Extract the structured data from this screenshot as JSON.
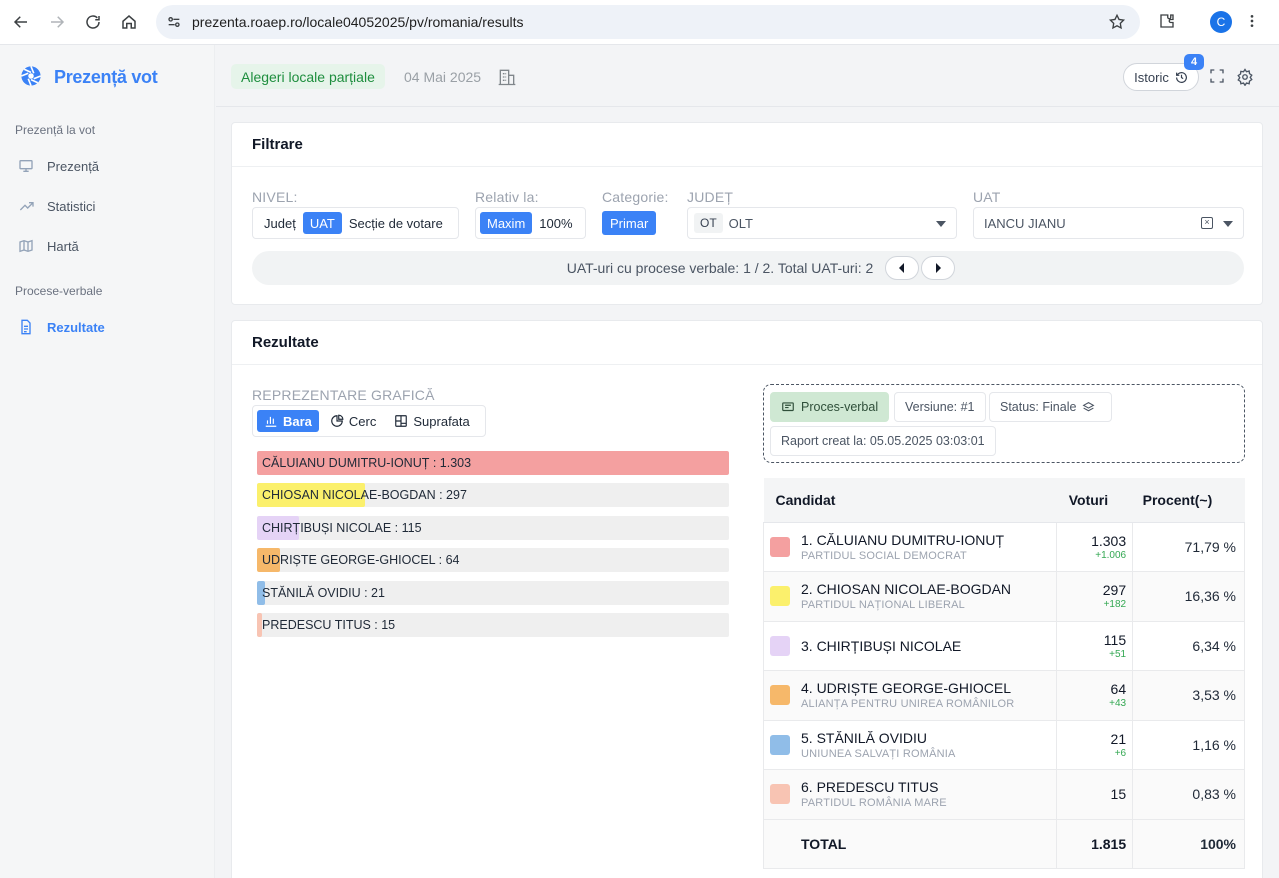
{
  "browser": {
    "url": "prezenta.roaep.ro/locale04052025/pv/romania/results",
    "profile_initial": "C"
  },
  "sidebar": {
    "brand": "Prezență vot",
    "section_presence": "Prezență la vot",
    "items_presence": [
      {
        "label": "Prezență",
        "icon": "monitor-icon"
      },
      {
        "label": "Statistici",
        "icon": "trend-icon"
      },
      {
        "label": "Hartă",
        "icon": "map-icon"
      }
    ],
    "section_pv": "Procese-verbale",
    "item_results": {
      "label": "Rezultate",
      "icon": "document-icon"
    }
  },
  "topbar": {
    "election_name": "Alegeri locale parțiale",
    "election_date": "04 Mai 2025",
    "history_label": "Istoric",
    "history_count": "4"
  },
  "filters": {
    "title": "Filtrare",
    "nivel_label": "NIVEL:",
    "nivel_options": [
      "Județ",
      "UAT",
      "Secție de votare"
    ],
    "nivel_selected": "UAT",
    "relativ_label": "Relativ la:",
    "relativ_options": [
      "Maxim",
      "100%"
    ],
    "relativ_selected": "Maxim",
    "categorie_label": "Categorie:",
    "categorie_value": "Primar",
    "judet_label": "JUDEȚ",
    "judet_code": "OT",
    "judet_value": "OLT",
    "uat_label": "UAT",
    "uat_value": "IANCU JIANU",
    "pager_text": "UAT-uri cu procese verbale: 1 / 2. Total UAT-uri: 2"
  },
  "results": {
    "title": "Rezultate",
    "grafica_label": "REPREZENTARE GRAFICĂ",
    "chart_tabs": [
      "Bara",
      "Cerc",
      "Suprafata"
    ],
    "chart_tab_selected": "Bara",
    "pv_chip": "Proces-verbal",
    "version_chip": "Versiune: #1",
    "status_chip": "Status: Finale",
    "report_chip": "Raport creat la: 05.05.2025 03:03:01",
    "table_headers": {
      "candidate": "Candidat",
      "votes": "Voturi",
      "percent": "Procent(~)"
    },
    "candidates": [
      {
        "rank_name": "1. CĂLUIANU DUMITRU-IONUȚ",
        "party": "PARTIDUL SOCIAL DEMOCRAT",
        "votes": "1.303",
        "delta": "+1.006",
        "percent": "71,79 %",
        "color": "#f4a0a0"
      },
      {
        "rank_name": "2. CHIOSAN NICOLAE-BOGDAN",
        "party": "PARTIDUL NAȚIONAL LIBERAL",
        "votes": "297",
        "delta": "+182",
        "percent": "16,36 %",
        "color": "#fbf06c"
      },
      {
        "rank_name": "3. CHIRȚIBUȘI NICOLAE",
        "party": "",
        "votes": "115",
        "delta": "+51",
        "percent": "6,34 %",
        "color": "#e5d3f6"
      },
      {
        "rank_name": "4. UDRIȘTE GEORGE-GHIOCEL",
        "party": "ALIANȚA PENTRU UNIREA ROMÂNILOR",
        "votes": "64",
        "delta": "+43",
        "percent": "3,53 %",
        "color": "#f6b86a"
      },
      {
        "rank_name": "5. STĂNILĂ OVIDIU",
        "party": "UNIUNEA SALVAȚI ROMÂNIA",
        "votes": "21",
        "delta": "+6",
        "percent": "1,16 %",
        "color": "#90bde8"
      },
      {
        "rank_name": "6. PREDESCU TITUS",
        "party": "PARTIDUL ROMÂNIA MARE",
        "votes": "15",
        "delta": "",
        "percent": "0,83 %",
        "color": "#f8c4b3"
      }
    ],
    "total_label": "TOTAL",
    "total_votes": "1.815",
    "total_percent": "100%"
  },
  "chart_data": {
    "type": "bar",
    "orientation": "horizontal",
    "categories": [
      "CĂLUIANU DUMITRU-IONUȚ",
      "CHIOSAN NICOLAE-BOGDAN",
      "CHIRȚIBUȘI NICOLAE",
      "UDRIȘTE GEORGE-GHIOCEL",
      "STĂNILĂ OVIDIU",
      "PREDESCU TITUS"
    ],
    "values": [
      1303,
      297,
      115,
      64,
      21,
      15
    ],
    "value_labels": [
      "1.303",
      "297",
      "115",
      "64",
      "21",
      "15"
    ],
    "colors": [
      "#f4a0a0",
      "#fbf06c",
      "#e5d3f6",
      "#f6b86a",
      "#90bde8",
      "#f8c4b3"
    ],
    "xlim": [
      0,
      1303
    ],
    "scale": "relative to maximum"
  }
}
